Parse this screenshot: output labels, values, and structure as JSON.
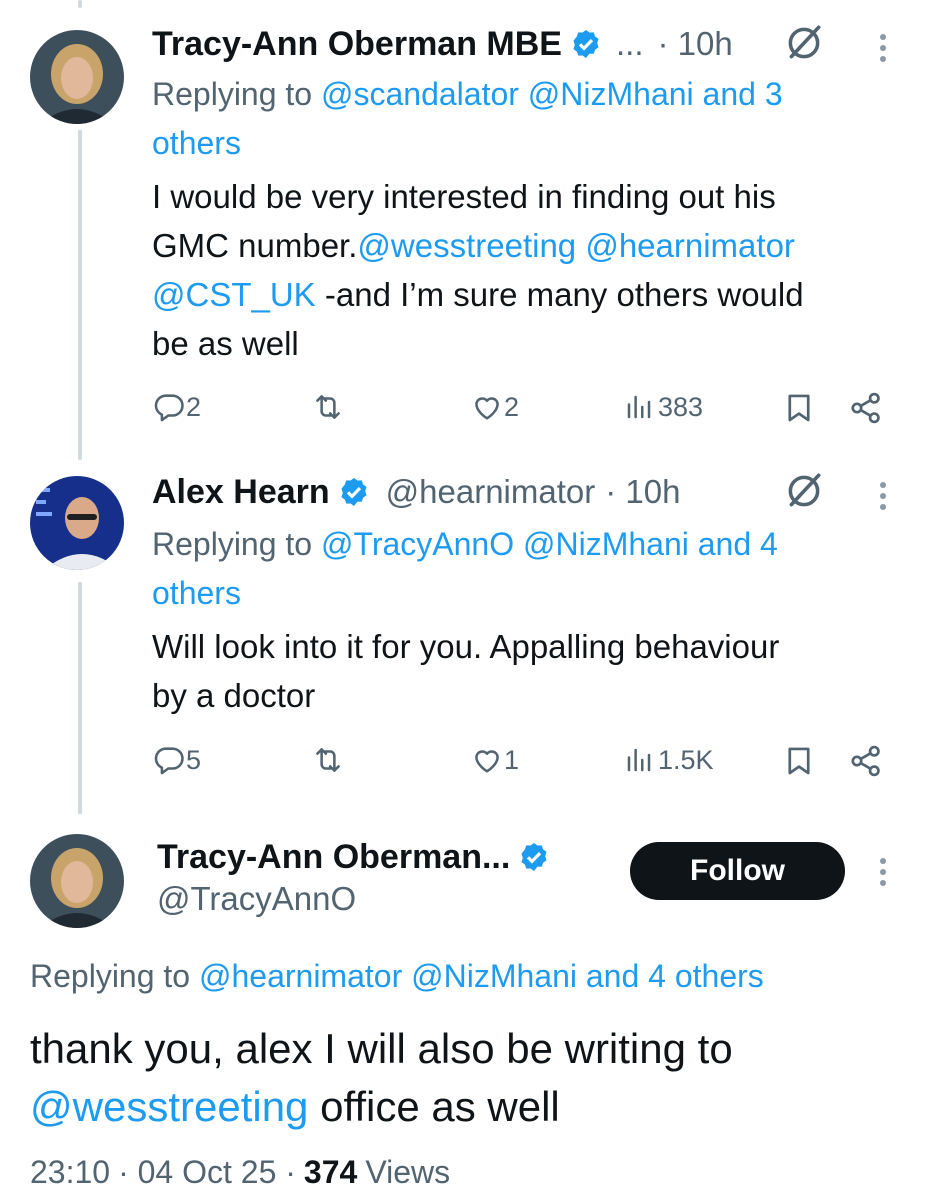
{
  "tweets": [
    {
      "name": "Tracy-Ann Oberman MBE",
      "ellipsis": "...",
      "time": "· 10h",
      "replying_prefix": "Replying to ",
      "replying_links": "@scandalator @NizMhani and 3",
      "replying_line2": "others",
      "body": [
        {
          "text": "I would be very interested in finding out his"
        },
        {
          "text": "GMC number.",
          "link": "@wesstreeting @hearnimator"
        },
        {
          "link": "@CST_UK",
          "text": " -and I’m sure many others would"
        },
        {
          "text": "be as well"
        }
      ],
      "replies": "2",
      "retweets": "",
      "likes": "2",
      "views": "383"
    },
    {
      "name": "Alex Hearn",
      "handle": "@hearnimator",
      "time": "· 10h",
      "replying_prefix": "Replying to ",
      "replying_links": "@TracyAnnO @NizMhani and 4",
      "replying_line2": "others",
      "body": [
        {
          "text": "Will look into it for you. Appalling behaviour"
        },
        {
          "text": "by a doctor"
        }
      ],
      "replies": "5",
      "retweets": "",
      "likes": "1",
      "views": "1.5K"
    }
  ],
  "main_tweet": {
    "name": "Tracy-Ann Oberman...",
    "handle": "@TracyAnnO",
    "follow_label": "Follow",
    "replying_prefix": "Replying to ",
    "replying_links": "@hearnimator @NizMhani and 4 others",
    "body_line1": "thank you, alex I will also be writing to",
    "body_link": "@wesstreeting",
    "body_line2_rest": " office as well",
    "time": "23:10",
    "date": "· 04 Oct 25 ·",
    "views_count": "374",
    "views_label": "Views"
  },
  "colors": {
    "link": "#1d9bf0",
    "secondary": "#536471",
    "verified": "#1d9bf0",
    "text": "#0f1419"
  },
  "icons": [
    "reply-icon",
    "retweet-icon",
    "like-icon",
    "views-icon",
    "bookmark-icon",
    "share-icon",
    "grok-icon",
    "more-icon",
    "verified-badge-icon"
  ]
}
